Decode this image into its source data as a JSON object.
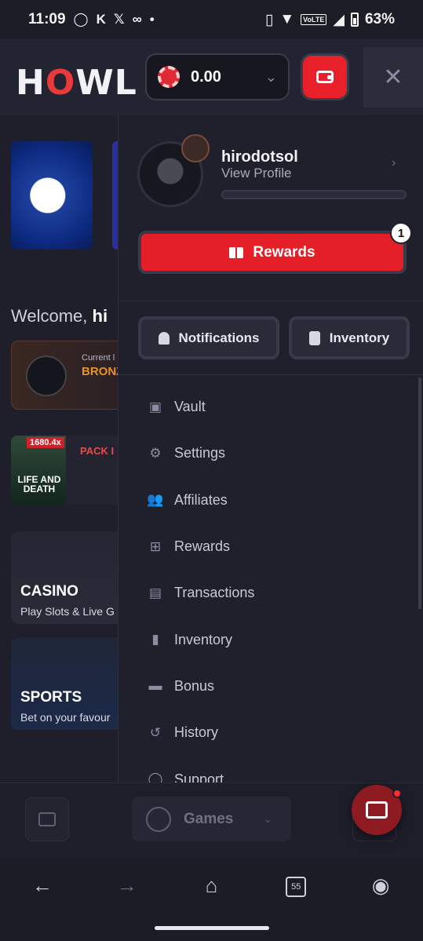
{
  "status_bar": {
    "time": "11:09",
    "battery": "63%",
    "network": "VoLTE"
  },
  "header": {
    "logo": "HOWL",
    "balance": "0.00"
  },
  "background_page": {
    "welcome": "Welcome,",
    "welcome_user": "hi",
    "rank_label": "Current l",
    "rank_name": "BRONZ",
    "pack_multiplier": "1680.4x",
    "pack_game": "LIFE AND DEATH",
    "pack_title": "PACK I",
    "casino_title": "CASINO",
    "casino_sub": "Play Slots & Live G",
    "sports_title": "SPORTS",
    "sports_sub": "Bet on your favour"
  },
  "drawer": {
    "username": "hirodotsol",
    "view_profile": "View Profile",
    "xp_progress": 0,
    "rewards_button": "Rewards",
    "rewards_count": "1",
    "notifications_button": "Notifications",
    "inventory_button": "Inventory",
    "menu": [
      {
        "label": "Vault",
        "icon": "vault-icon"
      },
      {
        "label": "Settings",
        "icon": "gear-icon"
      },
      {
        "label": "Affiliates",
        "icon": "users-icon"
      },
      {
        "label": "Rewards",
        "icon": "gift-icon"
      },
      {
        "label": "Transactions",
        "icon": "receipt-icon"
      },
      {
        "label": "Inventory",
        "icon": "backpack-icon"
      },
      {
        "label": "Bonus",
        "icon": "box-icon"
      },
      {
        "label": "History",
        "icon": "history-icon"
      },
      {
        "label": "Support",
        "icon": "support-icon"
      }
    ]
  },
  "bottom_bar": {
    "games_label": "Games"
  },
  "browser_nav": {
    "tabs_count": "55"
  },
  "colors": {
    "accent_red": "#e41f28",
    "bronze": "#e8902a",
    "background": "#1a1b26"
  }
}
